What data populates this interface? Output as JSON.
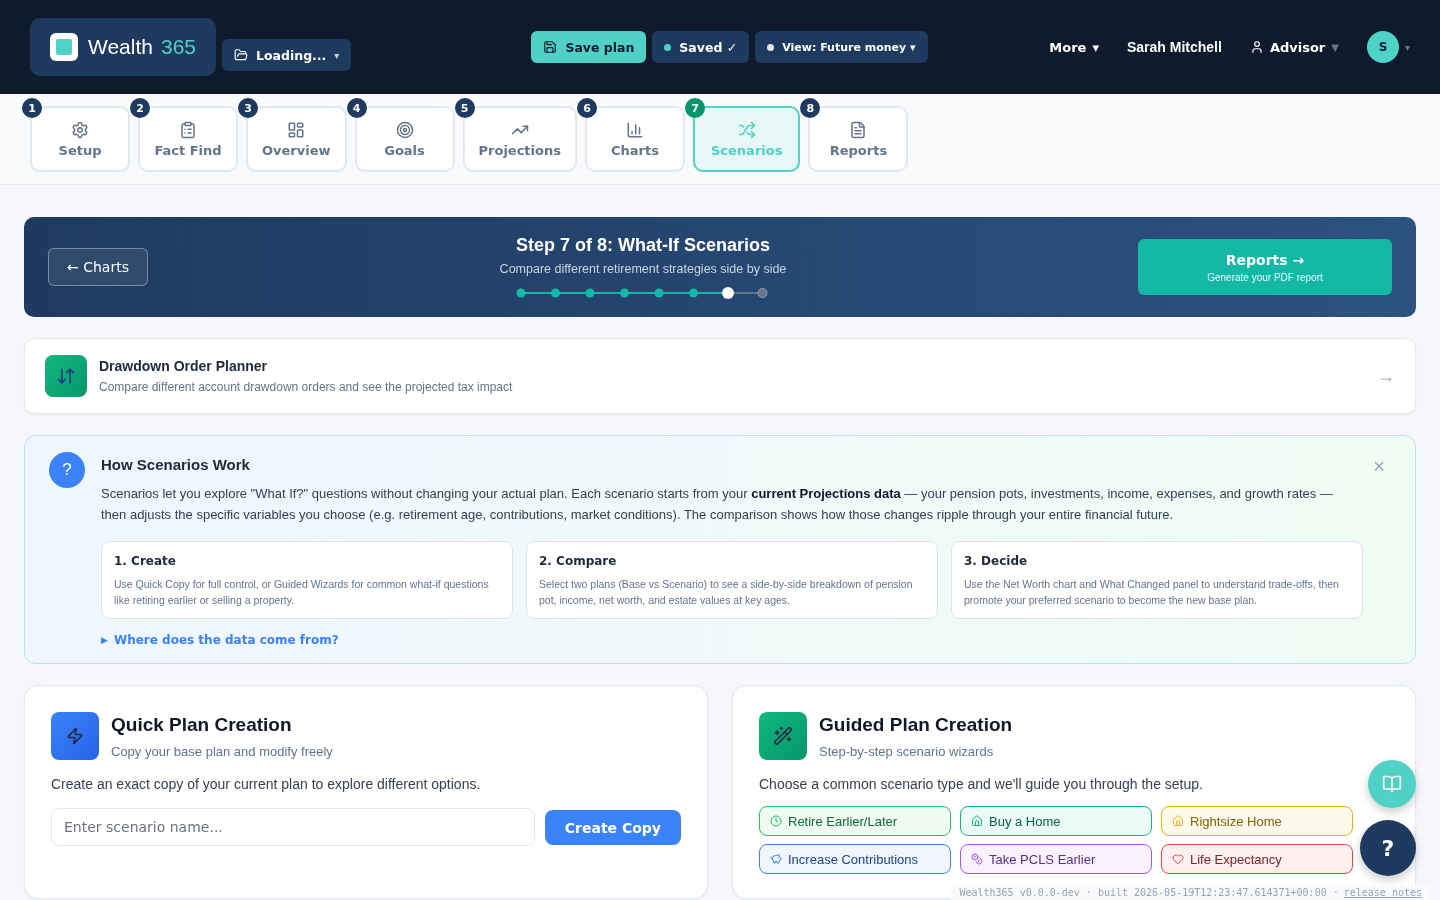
{
  "header": {
    "logo": {
      "name": "Wealth",
      "accent": "365"
    },
    "plan_selector": {
      "label": "Loading...",
      "caret": "▾"
    },
    "save_button": "Save plan",
    "save_status": "Saved ✓",
    "view_selector": "View: Future money ▾",
    "more_menu": {
      "label": "More",
      "caret": "▾"
    },
    "user_name": "Sarah Mitchell",
    "role_menu": {
      "label": "Advisor",
      "caret": "▼"
    },
    "avatar": {
      "initial": "S",
      "caret": "▾"
    }
  },
  "steps": [
    {
      "number": "1",
      "label": "Setup",
      "selected": false
    },
    {
      "number": "2",
      "label": "Fact Find",
      "selected": false
    },
    {
      "number": "3",
      "label": "Overview",
      "selected": false
    },
    {
      "number": "4",
      "label": "Goals",
      "selected": false
    },
    {
      "number": "5",
      "label": "Projections",
      "selected": false
    },
    {
      "number": "6",
      "label": "Charts",
      "selected": false
    },
    {
      "number": "7",
      "label": "Scenarios",
      "selected": true
    },
    {
      "number": "8",
      "label": "Reports",
      "selected": false
    }
  ],
  "step_banner": {
    "back_button": "← Charts",
    "title": "Step 7 of 8: What-If Scenarios",
    "subtitle": "Compare different retirement strategies side by side",
    "next_button": {
      "label": "Reports →",
      "hint": "Generate your PDF report"
    }
  },
  "drawdown_card": {
    "title": "Drawdown Order Planner",
    "description": "Compare different account drawdown orders and see the projected tax impact",
    "arrow": "→"
  },
  "how_it_works": {
    "icon": "?",
    "title": "How Scenarios Work",
    "body": "Scenarios let you explore \"What If?\" questions without changing your actual plan. Each scenario starts from your **current Projections data** — your pension pots, investments, income, expenses, and growth rates — then adjusts the specific variables you choose (e.g. retirement age, contributions, market conditions). The comparison shows how those changes ripple through your entire financial future.",
    "close": "×",
    "steps": [
      {
        "title": "1. Create",
        "text": "Use Quick Copy for full control, or Guided Wizards for common what-if questions like retiring earlier or selling a property."
      },
      {
        "title": "2. Compare",
        "text": "Select two plans (Base vs Scenario) to see a side-by-side breakdown of pension pot, income, net worth, and estate values at key ages."
      },
      {
        "title": "3. Decide",
        "text": "Use the Net Worth chart and What Changed panel to understand trade-offs, then promote your preferred scenario to become the new base plan."
      }
    ],
    "details_icon": "▶",
    "details_link": "Where does the data come from?",
    "expanded": false
  },
  "quick_plan": {
    "title": "Quick Plan Creation",
    "subtitle": "Copy your base plan and modify freely",
    "description": "Create an exact copy of your current plan to explore different options.",
    "name_field": {
      "placeholder": "Enter scenario name..."
    },
    "create_button": "Create Copy"
  },
  "guided_plan": {
    "title": "Guided Plan Creation",
    "subtitle": "Step-by-step scenario wizards",
    "description": "Choose a common scenario type and we'll guide you through the setup.",
    "wizards": [
      {
        "label": "Retire Earlier/Later",
        "color": "#22c55e"
      },
      {
        "label": "Buy a Home",
        "color": "#10b981"
      },
      {
        "label": "Rightsize Home",
        "color": "#eab308"
      },
      {
        "label": "Increase Contributions",
        "color": "#3b82f6"
      },
      {
        "label": "Take PCLS Earlier",
        "color": "#a855f7"
      },
      {
        "label": "Life Expectancy",
        "color": "#ef4444"
      }
    ]
  },
  "footer": {
    "build": "Wealth365 v0.0.0-dev · built 2026-05-19T12:23:47.614371+00:00 ·",
    "link": "release notes"
  }
}
